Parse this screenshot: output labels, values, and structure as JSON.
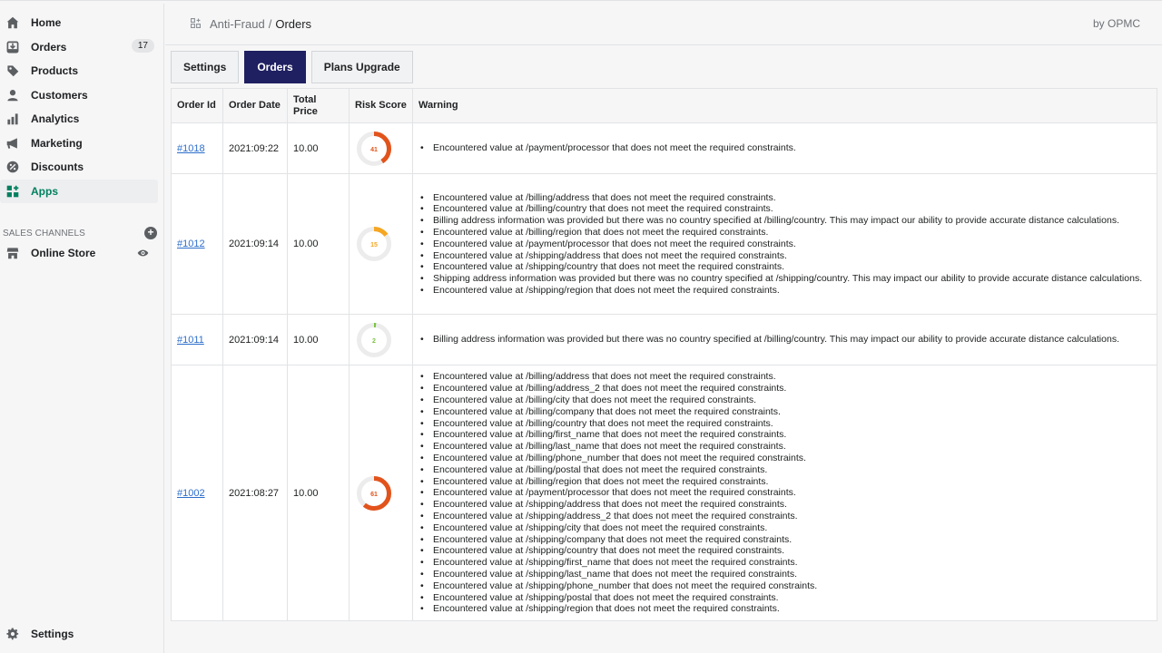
{
  "sidebar": {
    "items": [
      {
        "label": "Home",
        "icon": "home-icon"
      },
      {
        "label": "Orders",
        "icon": "orders-icon",
        "badge": "17"
      },
      {
        "label": "Products",
        "icon": "tag-icon"
      },
      {
        "label": "Customers",
        "icon": "person-icon"
      },
      {
        "label": "Analytics",
        "icon": "bar-chart-icon"
      },
      {
        "label": "Marketing",
        "icon": "megaphone-icon"
      },
      {
        "label": "Discounts",
        "icon": "discount-icon"
      },
      {
        "label": "Apps",
        "icon": "apps-icon",
        "active": true
      }
    ],
    "sales_channels_label": "SALES CHANNELS",
    "online_store_label": "Online Store",
    "settings_label": "Settings"
  },
  "header": {
    "app_name": "Anti-Fraud",
    "separator": "/",
    "page": "Orders",
    "by": "by OPMC"
  },
  "tabs": [
    {
      "label": "Settings",
      "active": false
    },
    {
      "label": "Orders",
      "active": true
    },
    {
      "label": "Plans Upgrade",
      "active": false
    }
  ],
  "table": {
    "headers": {
      "order_id": "Order Id",
      "order_date": "Order Date",
      "total_price": "Total Price",
      "risk_score": "Risk Score",
      "warning": "Warning"
    },
    "rows": [
      {
        "order_id": "#1018",
        "order_date": "2021:09:22",
        "total_price": "10.00",
        "risk_score": "41",
        "risk_color": "#e2531b",
        "warnings": [
          "Encountered value at /payment/processor that does not meet the required constraints."
        ]
      },
      {
        "order_id": "#1012",
        "order_date": "2021:09:14",
        "total_price": "10.00",
        "risk_score": "15",
        "risk_color": "#f5a623",
        "warnings": [
          "Encountered value at /billing/address that does not meet the required constraints.",
          "Encountered value at /billing/country that does not meet the required constraints.",
          "Billing address information was provided but there was no country specified at /billing/country. This may impact our ability to provide accurate distance calculations.",
          "Encountered value at /billing/region that does not meet the required constraints.",
          "Encountered value at /payment/processor that does not meet the required constraints.",
          "Encountered value at /shipping/address that does not meet the required constraints.",
          "Encountered value at /shipping/country that does not meet the required constraints.",
          "Shipping address information was provided but there was no country specified at /shipping/country. This may impact our ability to provide accurate distance calculations.",
          "Encountered value at /shipping/region that does not meet the required constraints."
        ]
      },
      {
        "order_id": "#1011",
        "order_date": "2021:09:14",
        "total_price": "10.00",
        "risk_score": "2",
        "risk_color": "#7cc242",
        "warnings": [
          "Billing address information was provided but there was no country specified at /billing/country. This may impact our ability to provide accurate distance calculations."
        ]
      },
      {
        "order_id": "#1002",
        "order_date": "2021:08:27",
        "total_price": "10.00",
        "risk_score": "61",
        "risk_color": "#e2531b",
        "warnings": [
          "Encountered value at /billing/address that does not meet the required constraints.",
          "Encountered value at /billing/address_2 that does not meet the required constraints.",
          "Encountered value at /billing/city that does not meet the required constraints.",
          "Encountered value at /billing/company that does not meet the required constraints.",
          "Encountered value at /billing/country that does not meet the required constraints.",
          "Encountered value at /billing/first_name that does not meet the required constraints.",
          "Encountered value at /billing/last_name that does not meet the required constraints.",
          "Encountered value at /billing/phone_number that does not meet the required constraints.",
          "Encountered value at /billing/postal that does not meet the required constraints.",
          "Encountered value at /billing/region that does not meet the required constraints.",
          "Encountered value at /payment/processor that does not meet the required constraints.",
          "Encountered value at /shipping/address that does not meet the required constraints.",
          "Encountered value at /shipping/address_2 that does not meet the required constraints.",
          "Encountered value at /shipping/city that does not meet the required constraints.",
          "Encountered value at /shipping/company that does not meet the required constraints.",
          "Encountered value at /shipping/country that does not meet the required constraints.",
          "Encountered value at /shipping/first_name that does not meet the required constraints.",
          "Encountered value at /shipping/last_name that does not meet the required constraints.",
          "Encountered value at /shipping/phone_number that does not meet the required constraints.",
          "Encountered value at /shipping/postal that does not meet the required constraints.",
          "Encountered value at /shipping/region that does not meet the required constraints."
        ]
      }
    ]
  },
  "colors": {
    "accent": "#1f2061",
    "apps_active": "#008060",
    "link": "#2c6ecb"
  }
}
